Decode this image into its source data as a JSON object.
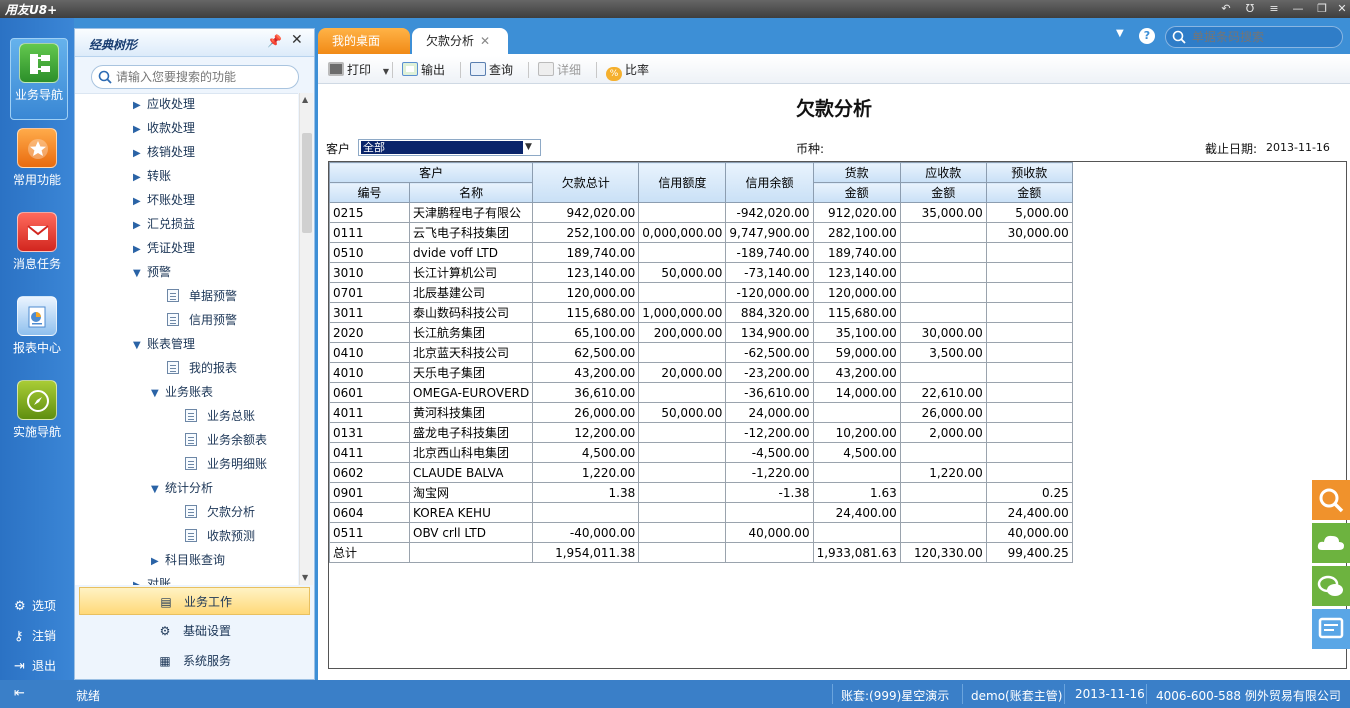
{
  "app": {
    "title": "用友U8+"
  },
  "window_controls": [
    "↶",
    "Ʊ",
    "≡",
    "—",
    "❐",
    "✕"
  ],
  "left_rail": {
    "items": [
      {
        "label": "业务导航",
        "icon": "business-nav-icon",
        "active": true
      },
      {
        "label": "常用功能",
        "icon": "star-icon"
      },
      {
        "label": "消息任务",
        "icon": "mail-icon"
      },
      {
        "label": "报表中心",
        "icon": "report-icon"
      },
      {
        "label": "实施导航",
        "icon": "compass-icon"
      }
    ],
    "bottom": [
      {
        "label": "选项",
        "icon": "gear-icon"
      },
      {
        "label": "注销",
        "icon": "key-icon"
      },
      {
        "label": "退出",
        "icon": "exit-icon"
      }
    ]
  },
  "nav_panel": {
    "title": "经典树形",
    "search_placeholder": "请输入您要搜索的功能",
    "tree": [
      {
        "label": "应收处理",
        "type": "folder",
        "level": 1,
        "expanded": false
      },
      {
        "label": "收款处理",
        "type": "folder",
        "level": 1,
        "expanded": false
      },
      {
        "label": "核销处理",
        "type": "folder",
        "level": 1,
        "expanded": false
      },
      {
        "label": "转账",
        "type": "folder",
        "level": 1,
        "expanded": false
      },
      {
        "label": "坏账处理",
        "type": "folder",
        "level": 1,
        "expanded": false
      },
      {
        "label": "汇兑损益",
        "type": "folder",
        "level": 1,
        "expanded": false
      },
      {
        "label": "凭证处理",
        "type": "folder",
        "level": 1,
        "expanded": false
      },
      {
        "label": "预警",
        "type": "folder",
        "level": 1,
        "expanded": true
      },
      {
        "label": "单据预警",
        "type": "doc",
        "level": 2
      },
      {
        "label": "信用预警",
        "type": "doc",
        "level": 2
      },
      {
        "label": "账表管理",
        "type": "folder",
        "level": 1,
        "expanded": true
      },
      {
        "label": "我的报表",
        "type": "doc",
        "level": 2
      },
      {
        "label": "业务账表",
        "type": "folder",
        "level": 2,
        "expanded": true
      },
      {
        "label": "业务总账",
        "type": "doc",
        "level": 3
      },
      {
        "label": "业务余额表",
        "type": "doc",
        "level": 3
      },
      {
        "label": "业务明细账",
        "type": "doc",
        "level": 3
      },
      {
        "label": "统计分析",
        "type": "folder",
        "level": 2,
        "expanded": true
      },
      {
        "label": "欠款分析",
        "type": "doc",
        "level": 3,
        "selected": true
      },
      {
        "label": "收款预测",
        "type": "doc",
        "level": 3
      },
      {
        "label": "科目账查询",
        "type": "folder",
        "level": 2,
        "expanded": false
      },
      {
        "label": "对账",
        "type": "folder",
        "level": 1,
        "expanded": false
      }
    ],
    "groups": [
      {
        "label": "业务工作",
        "icon": "business-work-icon",
        "active": true
      },
      {
        "label": "基础设置",
        "icon": "settings-icon"
      },
      {
        "label": "系统服务",
        "icon": "system-service-icon"
      }
    ]
  },
  "tabs": [
    {
      "label": "我的桌面"
    },
    {
      "label": "欠款分析",
      "close": "✕"
    }
  ],
  "top_search": {
    "placeholder": "单据条码搜索"
  },
  "toolbar": {
    "print": "打印",
    "export": "输出",
    "query": "查询",
    "detail": "详细",
    "ratio": "比率"
  },
  "report": {
    "title": "欠款分析",
    "customer_label": "客户",
    "customer_value": "全部",
    "currency_label": "币种:",
    "date_label": "截止日期:",
    "date_value": "2013-11-16",
    "header_top": {
      "customer": "客户",
      "total": "欠款总计",
      "credit_limit": "信用额度",
      "credit_balance": "信用余额",
      "goods": "货款",
      "receivable": "应收款",
      "prepaid": "预收款"
    },
    "header_sub": {
      "code": "编号",
      "name": "名称",
      "amount": "金额"
    },
    "rows": [
      {
        "code": "0215",
        "name": "天津鹏程电子有限公",
        "total": "942,020.00",
        "limit": "",
        "balance": "-942,020.00",
        "goods": "912,020.00",
        "recv": "35,000.00",
        "pre": "5,000.00"
      },
      {
        "code": "0111",
        "name": "云飞电子科技集团",
        "total": "252,100.00",
        "limit": "0,000,000.00",
        "balance": "9,747,900.00",
        "goods": "282,100.00",
        "recv": "",
        "pre": "30,000.00"
      },
      {
        "code": "0510",
        "name": "dvide voff LTD",
        "total": "189,740.00",
        "limit": "",
        "balance": "-189,740.00",
        "goods": "189,740.00",
        "recv": "",
        "pre": ""
      },
      {
        "code": "3010",
        "name": "长江计算机公司",
        "total": "123,140.00",
        "limit": "50,000.00",
        "balance": "-73,140.00",
        "goods": "123,140.00",
        "recv": "",
        "pre": ""
      },
      {
        "code": "0701",
        "name": "北辰基建公司",
        "total": "120,000.00",
        "limit": "",
        "balance": "-120,000.00",
        "goods": "120,000.00",
        "recv": "",
        "pre": ""
      },
      {
        "code": "3011",
        "name": "泰山数码科技公司",
        "total": "115,680.00",
        "limit": "1,000,000.00",
        "balance": "884,320.00",
        "goods": "115,680.00",
        "recv": "",
        "pre": ""
      },
      {
        "code": "2020",
        "name": "长江航务集团",
        "total": "65,100.00",
        "limit": "200,000.00",
        "balance": "134,900.00",
        "goods": "35,100.00",
        "recv": "30,000.00",
        "pre": ""
      },
      {
        "code": "0410",
        "name": "北京蓝天科技公司",
        "total": "62,500.00",
        "limit": "",
        "balance": "-62,500.00",
        "goods": "59,000.00",
        "recv": "3,500.00",
        "pre": ""
      },
      {
        "code": "4010",
        "name": "天乐电子集团",
        "total": "43,200.00",
        "limit": "20,000.00",
        "balance": "-23,200.00",
        "goods": "43,200.00",
        "recv": "",
        "pre": ""
      },
      {
        "code": "0601",
        "name": "OMEGA-EUROVERD",
        "total": "36,610.00",
        "limit": "",
        "balance": "-36,610.00",
        "goods": "14,000.00",
        "recv": "22,610.00",
        "pre": ""
      },
      {
        "code": "4011",
        "name": "黄河科技集团",
        "total": "26,000.00",
        "limit": "50,000.00",
        "balance": "24,000.00",
        "goods": "",
        "recv": "26,000.00",
        "pre": ""
      },
      {
        "code": "0131",
        "name": "盛龙电子科技集团",
        "total": "12,200.00",
        "limit": "",
        "balance": "-12,200.00",
        "goods": "10,200.00",
        "recv": "2,000.00",
        "pre": ""
      },
      {
        "code": "0411",
        "name": "北京西山科电集团",
        "total": "4,500.00",
        "limit": "",
        "balance": "-4,500.00",
        "goods": "4,500.00",
        "recv": "",
        "pre": ""
      },
      {
        "code": "0602",
        "name": "CLAUDE BALVA",
        "total": "1,220.00",
        "limit": "",
        "balance": "-1,220.00",
        "goods": "",
        "recv": "1,220.00",
        "pre": ""
      },
      {
        "code": "0901",
        "name": "淘宝网",
        "total": "1.38",
        "limit": "",
        "balance": "-1.38",
        "goods": "1.63",
        "recv": "",
        "pre": "0.25"
      },
      {
        "code": "0604",
        "name": "KOREA KEHU",
        "total": "",
        "limit": "",
        "balance": "",
        "goods": "24,400.00",
        "recv": "",
        "pre": "24,400.00"
      },
      {
        "code": "0511",
        "name": "OBV crll LTD",
        "total": "-40,000.00",
        "limit": "",
        "balance": "40,000.00",
        "goods": "",
        "recv": "",
        "pre": "40,000.00"
      },
      {
        "code": "总计",
        "name": "",
        "total": "1,954,011.38",
        "limit": "",
        "balance": "",
        "goods": "1,933,081.63",
        "recv": "120,330.00",
        "pre": "99,400.25"
      }
    ]
  },
  "status_bar": {
    "status": "就绪",
    "account": "账套:(999)星空演示",
    "user": "demo(账套主管)",
    "date": "2013-11-16",
    "contact": "4006-600-588 例外贸易有限公司"
  }
}
